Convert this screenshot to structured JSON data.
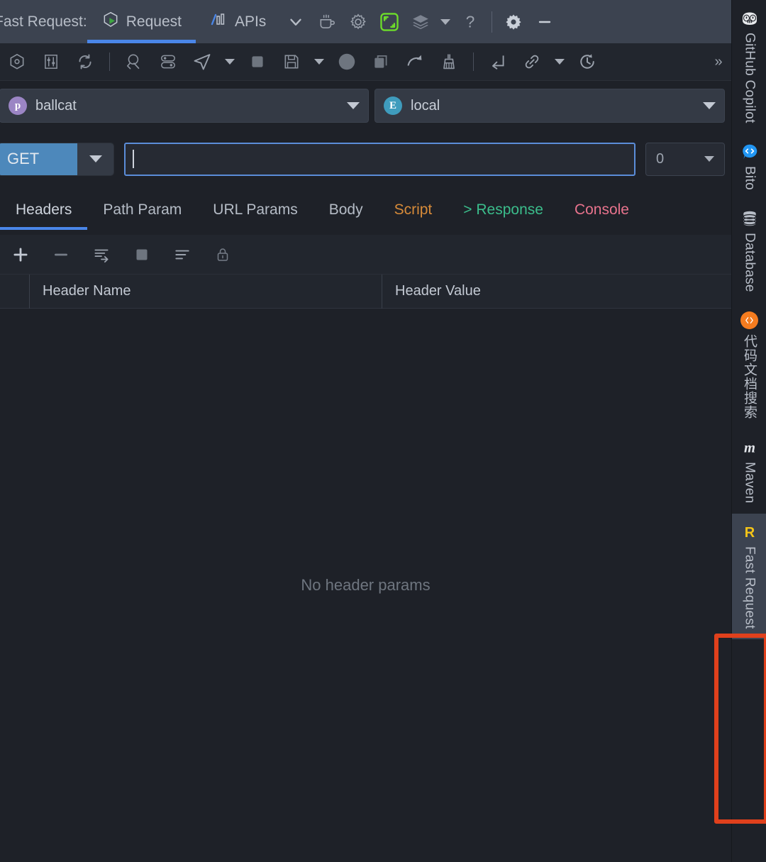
{
  "window": {
    "tool_window_label": "Fast Request:",
    "tabs": [
      {
        "label": "Request",
        "icon": "request-shield-play-icon",
        "active": true
      },
      {
        "label": "APIs",
        "icon": "apis-bars-icon",
        "active": false
      }
    ],
    "title_actions": [
      {
        "name": "chevron-down-icon",
        "glyph": "chevron-down"
      },
      {
        "name": "coffee-cup-icon",
        "glyph": "coffee"
      },
      {
        "name": "settings-gear-outline-icon",
        "glyph": "gear-outline"
      },
      {
        "name": "expand-frame-icon",
        "glyph": "frame",
        "color": "#6ddd2a"
      },
      {
        "name": "layers-icon",
        "glyph": "layers"
      },
      {
        "name": "layers-dropdown-icon",
        "glyph": "caret"
      },
      {
        "name": "help-question-icon",
        "glyph": "question"
      },
      {
        "name": "tool-settings-gear-icon",
        "glyph": "gear-solid"
      },
      {
        "name": "minimize-icon",
        "glyph": "minus"
      }
    ]
  },
  "icon_toolbar": {
    "buttons": [
      {
        "name": "hexagon-target-icon",
        "glyph": "hex-dot"
      },
      {
        "name": "sliders-filter-icon",
        "glyph": "sliders"
      },
      {
        "name": "refresh-sync-icon",
        "glyph": "refresh"
      },
      {
        "name": "search-code-icon",
        "glyph": "search-code"
      },
      {
        "name": "toggles-list-icon",
        "glyph": "toggles"
      },
      {
        "name": "send-request-icon",
        "glyph": "send"
      },
      {
        "name": "send-dropdown-icon",
        "glyph": "caret"
      },
      {
        "name": "stop-square-icon",
        "glyph": "stop"
      },
      {
        "name": "save-disk-icon",
        "glyph": "save"
      },
      {
        "name": "save-dropdown-icon",
        "glyph": "caret"
      },
      {
        "name": "record-circle-icon",
        "glyph": "circle"
      },
      {
        "name": "copy-icon",
        "glyph": "copy"
      },
      {
        "name": "redo-arrow-icon",
        "glyph": "redo"
      },
      {
        "name": "clear-broom-icon",
        "glyph": "broom"
      },
      {
        "name": "collapse-arrow-icon",
        "glyph": "collapse"
      },
      {
        "name": "link-chain-icon",
        "glyph": "link"
      },
      {
        "name": "link-dropdown-icon",
        "glyph": "caret"
      },
      {
        "name": "history-clock-icon",
        "glyph": "history"
      }
    ],
    "overflow_label": "»"
  },
  "selectors": {
    "project": {
      "badge": "p",
      "badge_color": "#9b85c4",
      "value": "ballcat"
    },
    "environment": {
      "badge": "E",
      "badge_color": "#3f9cbd",
      "value": "local"
    }
  },
  "request": {
    "method": "GET",
    "method_color": "#4d88bb",
    "url_value": "",
    "url_placeholder": "",
    "count_value": "0"
  },
  "request_tabs": [
    {
      "label": "Headers",
      "active": true,
      "color": "#cdd3dc"
    },
    {
      "label": "Path Param",
      "active": false,
      "color": "#b5bcc6"
    },
    {
      "label": "URL Params",
      "active": false,
      "color": "#b5bcc6"
    },
    {
      "label": "Body",
      "active": false,
      "color": "#b5bcc6"
    },
    {
      "label": "Script",
      "active": false,
      "color": "#d68a39"
    },
    {
      "label": "> Response",
      "active": false,
      "color": "#3bbd8b"
    },
    {
      "label": "Console",
      "active": false,
      "color": "#e8738d"
    }
  ],
  "param_toolbar": [
    {
      "name": "add-param-icon",
      "glyph": "plus"
    },
    {
      "name": "remove-param-icon",
      "glyph": "minus"
    },
    {
      "name": "import-params-icon",
      "glyph": "import"
    },
    {
      "name": "stop-square-icon",
      "glyph": "stop"
    },
    {
      "name": "format-lines-icon",
      "glyph": "lines"
    },
    {
      "name": "lock-icon",
      "glyph": "lock"
    }
  ],
  "headers_table": {
    "columns": [
      "Header Name",
      "Header Value"
    ],
    "rows": [],
    "empty_message": "No header params"
  },
  "right_rail": [
    {
      "label": "GitHub Copilot",
      "icon": "copilot-icon",
      "selected": false,
      "cjk": false
    },
    {
      "label": "Bito",
      "icon": "bito-code-bubble-icon",
      "selected": false,
      "cjk": false
    },
    {
      "label": "Database",
      "icon": "database-icon",
      "selected": false,
      "cjk": false
    },
    {
      "label": "代码文档搜索",
      "icon": "code-doc-search-icon",
      "selected": false,
      "cjk": true
    },
    {
      "label": "Maven",
      "icon": "maven-m-icon",
      "selected": false,
      "cjk": false
    },
    {
      "label": "Fast Request",
      "icon": "fast-request-r-icon",
      "selected": true,
      "cjk": false
    }
  ],
  "annotation": {
    "highlight_color": "#e0401c",
    "target": "Fast Request"
  }
}
